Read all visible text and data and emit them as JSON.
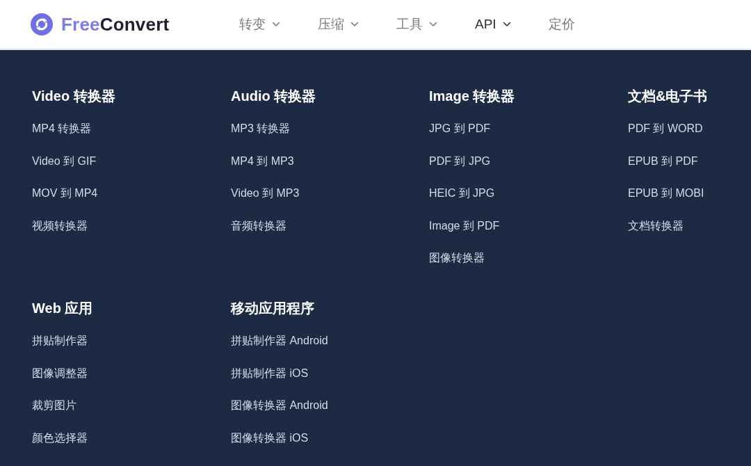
{
  "header": {
    "logo": {
      "parts": [
        {
          "text": "Free",
          "color": "#7b7ee6"
        },
        {
          "text": "Convert",
          "color": "#1e2130"
        }
      ]
    },
    "nav": [
      {
        "label": "转变",
        "dropdown": true,
        "selected": false
      },
      {
        "label": "压缩",
        "dropdown": true,
        "selected": false
      },
      {
        "label": "工具",
        "dropdown": true,
        "selected": false
      },
      {
        "label": "API",
        "dropdown": true,
        "selected": true
      },
      {
        "label": "定价",
        "dropdown": false,
        "selected": false
      }
    ]
  },
  "menu": {
    "sections": [
      {
        "title": "Video 转换器",
        "links": [
          "MP4 转换器",
          "Video 到 GIF",
          "MOV 到 MP4",
          "视频转换器"
        ]
      },
      {
        "title": "Audio 转换器",
        "links": [
          "MP3 转换器",
          "MP4 到 MP3",
          "Video 到 MP3",
          "音频转换器"
        ]
      },
      {
        "title": "Image 转换器",
        "links": [
          "JPG 到 PDF",
          "PDF 到 JPG",
          "HEIC 到 JPG",
          "Image 到 PDF",
          "图像转换器"
        ]
      },
      {
        "title": "文档&电子书",
        "links": [
          "PDF 到 WORD",
          "EPUB 到 PDF",
          "EPUB 到 MOBI",
          "文档转换器"
        ]
      },
      {
        "title": "Web 应用",
        "links": [
          "拼贴制作器",
          "图像调整器",
          "裁剪图片",
          "颜色选择器"
        ]
      },
      {
        "title": "移动应用程序",
        "links": [
          "拼贴制作器 Android",
          "拼贴制作器 iOS",
          "图像转换器 Android",
          "图像转换器 iOS"
        ]
      }
    ]
  }
}
